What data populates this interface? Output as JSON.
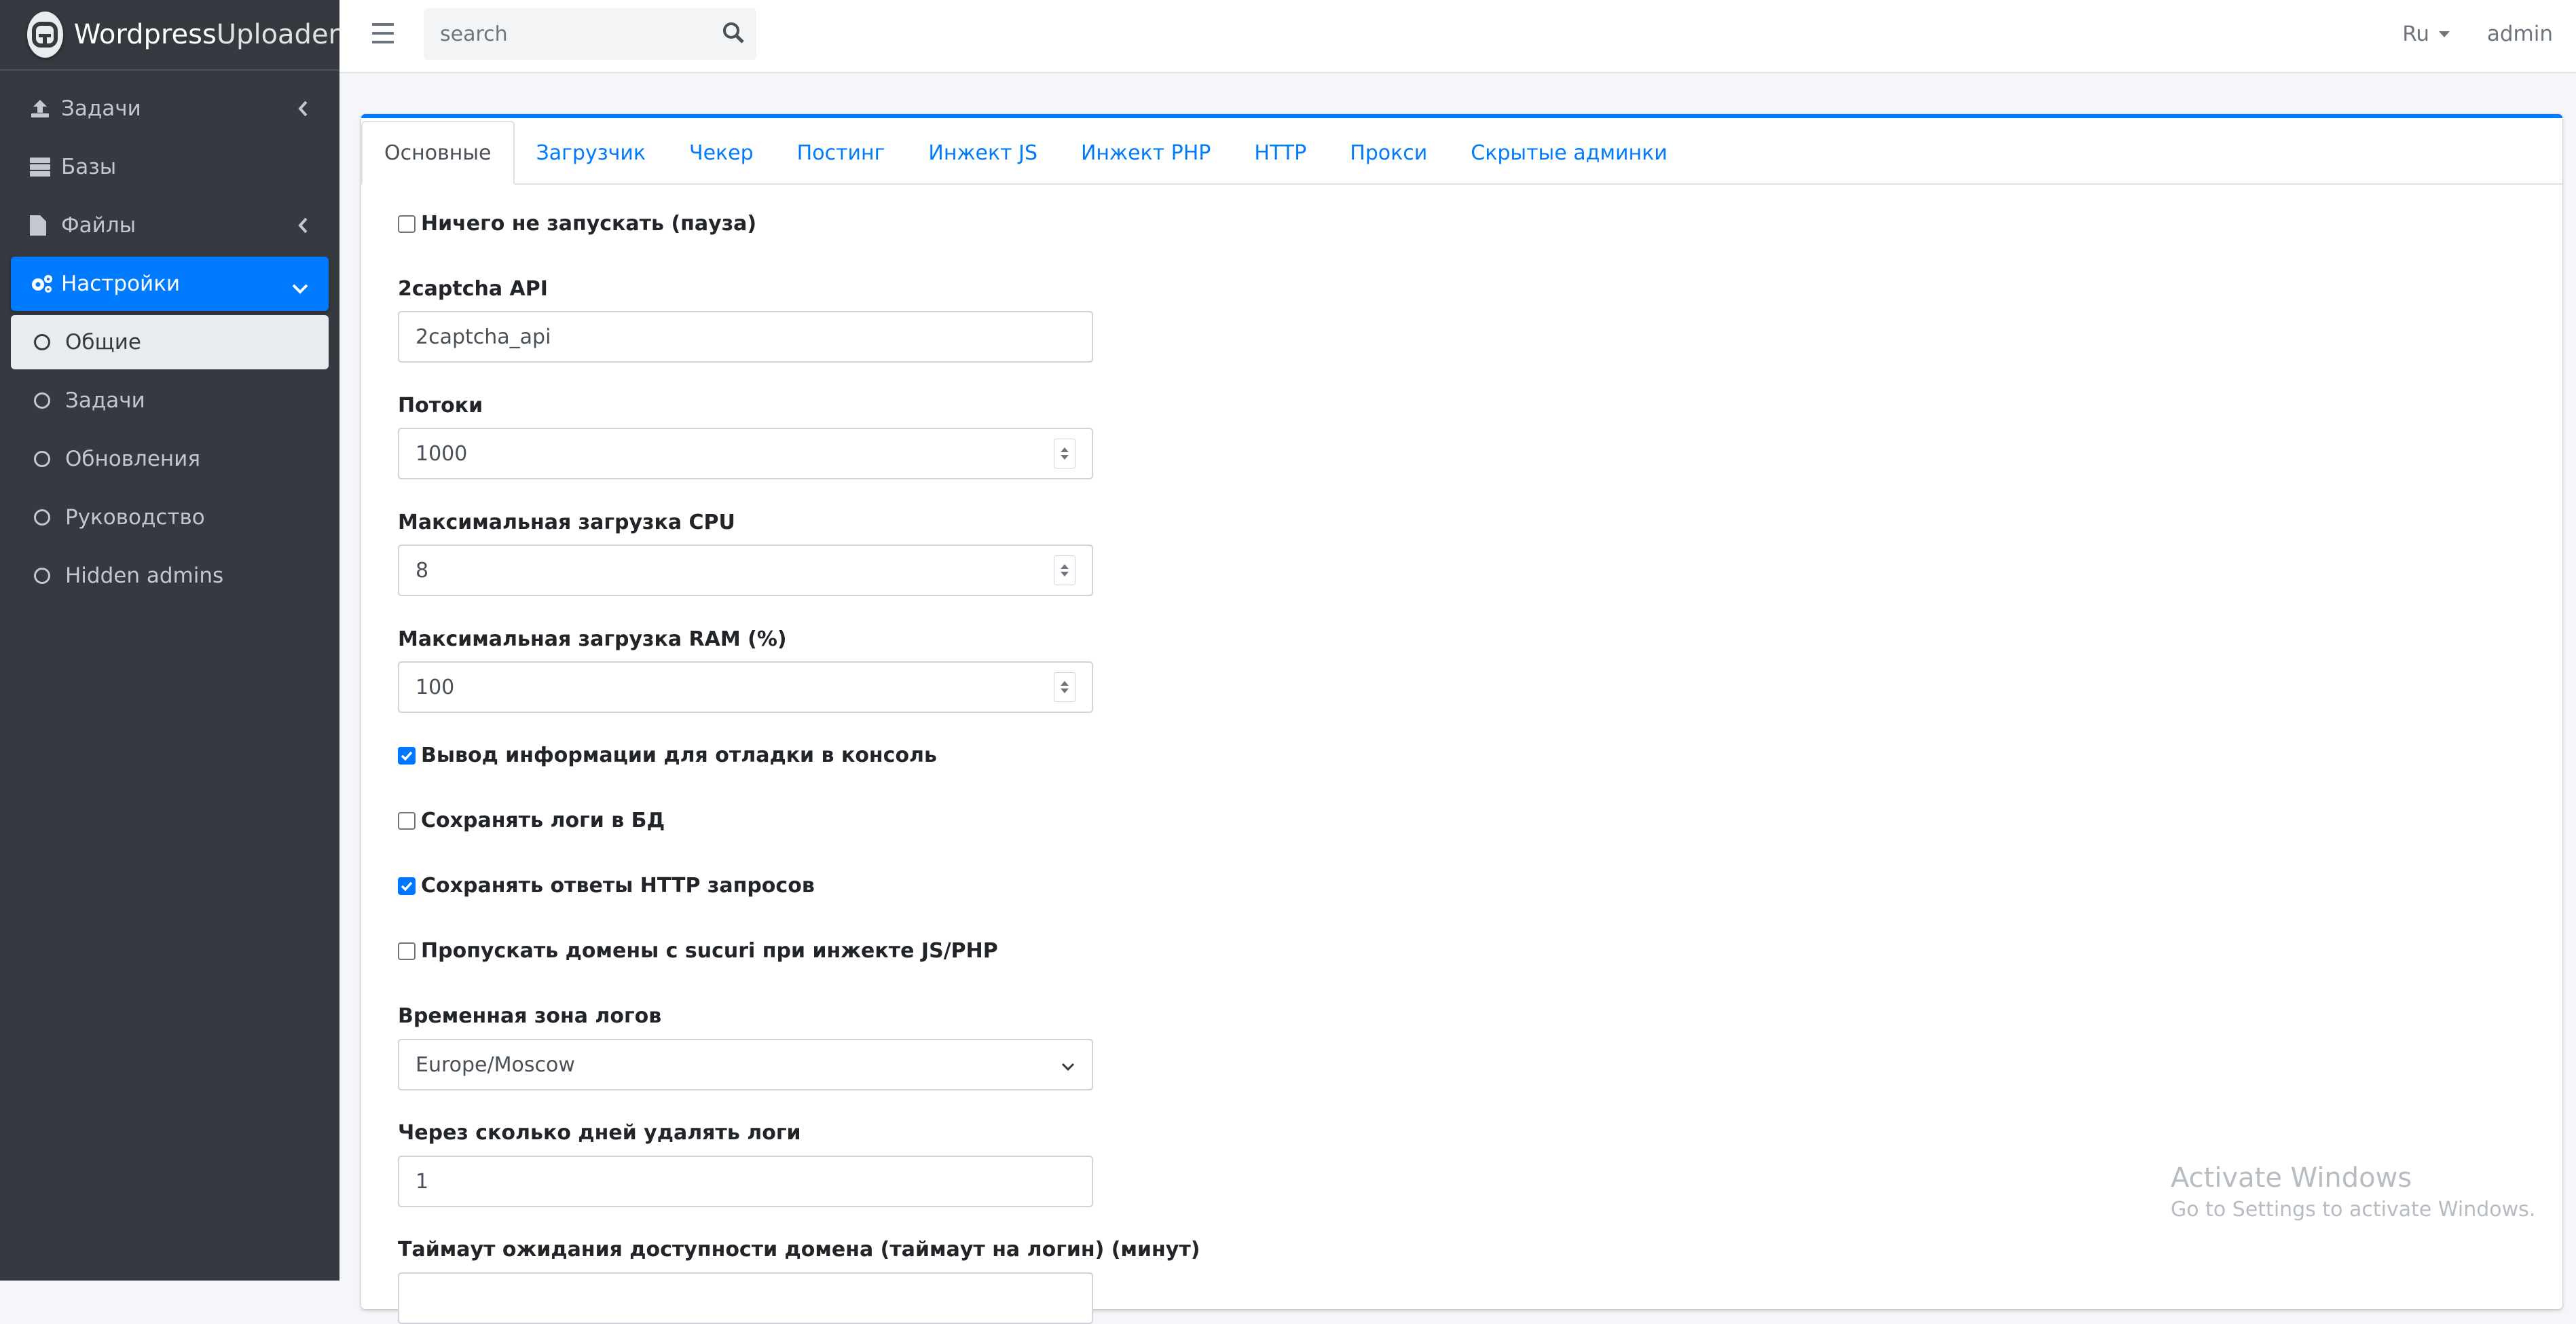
{
  "brand": {
    "name_bold": "Wordpress",
    "name_rest": "Uploader"
  },
  "sidebar": {
    "items": [
      {
        "label": "Задачи",
        "icon": "upload-icon",
        "arrow": "chevron-left-icon"
      },
      {
        "label": "Базы",
        "icon": "database-icon"
      },
      {
        "label": "Файлы",
        "icon": "file-icon",
        "arrow": "chevron-left-icon"
      },
      {
        "label": "Настройки",
        "icon": "gears-icon",
        "arrow": "chevron-down-icon"
      }
    ],
    "sub_items": [
      {
        "label": "Общие"
      },
      {
        "label": "Задачи"
      },
      {
        "label": "Обновления"
      },
      {
        "label": "Руководство"
      },
      {
        "label": "Hidden admins"
      }
    ]
  },
  "topbar": {
    "search_placeholder": "search",
    "language": "Ru",
    "user": "admin"
  },
  "tabs": [
    "Основные",
    "Загрузчик",
    "Чекер",
    "Постинг",
    "Инжект JS",
    "Инжект PHP",
    "HTTP",
    "Прокси",
    "Скрытые админки"
  ],
  "form": {
    "pause_label": "Ничего не запускать (пауза)",
    "captcha_label": "2captcha API",
    "captcha_value": "2captcha_api",
    "threads_label": "Потоки",
    "threads_value": "1000",
    "cpu_label": "Максимальная загрузка CPU",
    "cpu_value": "8",
    "ram_label": "Максимальная загрузка RAM (%)",
    "ram_value": "100",
    "debug_label": "Вывод информации для отладки в консоль",
    "save_logs_label": "Сохранять логи в БД",
    "save_http_label": "Сохранять ответы HTTP запросов",
    "skip_sucuri_label": "Пропускать домены с sucuri при инжекте JS/PHP",
    "timezone_label": "Временная зона логов",
    "timezone_value": "Europe/Moscow",
    "log_days_label": "Через сколько дней удалять логи",
    "log_days_value": "1",
    "timeout_label": "Таймаут ожидания доступности домена (таймаут на логин) (минут)"
  },
  "watermark": {
    "line1": "Activate Windows",
    "line2": "Go to Settings to activate Windows."
  }
}
